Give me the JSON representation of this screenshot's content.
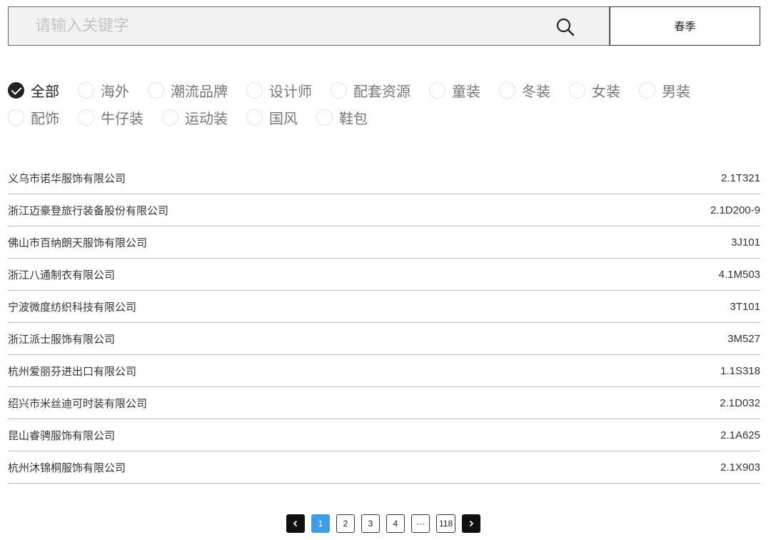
{
  "search": {
    "placeholder": "请输入关键字",
    "season_label": "春季"
  },
  "filters": {
    "row1": [
      {
        "label": "全部",
        "checked": true
      },
      {
        "label": "海外",
        "checked": false
      },
      {
        "label": "潮流品牌",
        "checked": false
      },
      {
        "label": "设计师",
        "checked": false
      },
      {
        "label": "配套资源",
        "checked": false
      },
      {
        "label": "童装",
        "checked": false
      },
      {
        "label": "冬装",
        "checked": false
      },
      {
        "label": "女装",
        "checked": false
      },
      {
        "label": "男装",
        "checked": false
      }
    ],
    "row2": [
      {
        "label": "配饰",
        "checked": false
      },
      {
        "label": "牛仔装",
        "checked": false
      },
      {
        "label": "运动装",
        "checked": false
      },
      {
        "label": "国风",
        "checked": false
      },
      {
        "label": "鞋包",
        "checked": false
      }
    ]
  },
  "companies": [
    {
      "name": "义乌市诺华服饰有限公司",
      "code": "2.1T321"
    },
    {
      "name": "浙江迈豪登旅行装备股份有限公司",
      "code": "2.1D200-9"
    },
    {
      "name": "佛山市百纳朗天服饰有限公司",
      "code": "3J101"
    },
    {
      "name": "浙江八通制衣有限公司",
      "code": "4.1M503"
    },
    {
      "name": "宁波微度纺织科技有限公司",
      "code": "3T101"
    },
    {
      "name": "浙江派士服饰有限公司",
      "code": "3M527"
    },
    {
      "name": "杭州爱丽芬进出口有限公司",
      "code": "1.1S318"
    },
    {
      "name": "绍兴市米丝迪可时装有限公司",
      "code": "2.1D032"
    },
    {
      "name": "昆山睿骋服饰有限公司",
      "code": "2.1A625"
    },
    {
      "name": "杭州沐锦桐服饰有限公司",
      "code": "2.1X903"
    }
  ],
  "pagination": {
    "pages": [
      "1",
      "2",
      "3",
      "4"
    ],
    "ellipsis": "···",
    "last_page": "118",
    "current": "1"
  },
  "colors": {
    "accent": "#3e9de8",
    "dark": "#111111"
  }
}
